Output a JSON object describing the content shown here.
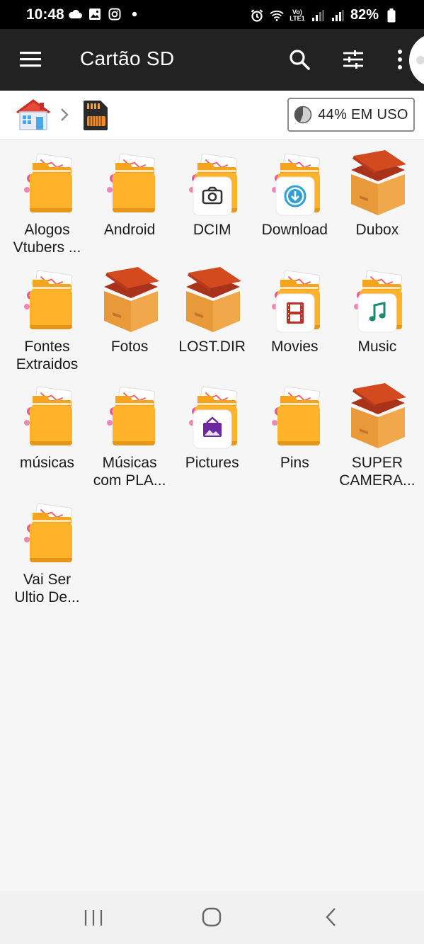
{
  "status_bar": {
    "time": "10:48",
    "network": "Vo) LTE1",
    "battery": "82%"
  },
  "app_bar": {
    "title": "Cartão SD"
  },
  "breadcrumb": {
    "usage_label": "44% EM USO",
    "usage_percent": 44
  },
  "folders": [
    {
      "label": "Alogos\nVtubers ...",
      "icon": "folder-icon",
      "badge": null
    },
    {
      "label": "Android",
      "icon": "folder-icon",
      "badge": null
    },
    {
      "label": "DCIM",
      "icon": "folder-icon",
      "badge": "camera-icon"
    },
    {
      "label": "Download",
      "icon": "folder-icon",
      "badge": "download-icon"
    },
    {
      "label": "Dubox",
      "icon": "box-icon",
      "badge": null
    },
    {
      "label": "Fontes\nExtraidos",
      "icon": "folder-icon",
      "badge": null
    },
    {
      "label": "Fotos",
      "icon": "box-icon",
      "badge": null
    },
    {
      "label": "LOST.DIR",
      "icon": "box-icon",
      "badge": null
    },
    {
      "label": "Movies",
      "icon": "folder-icon",
      "badge": "film-icon"
    },
    {
      "label": "Music",
      "icon": "folder-icon",
      "badge": "music-note-icon"
    },
    {
      "label": "músicas",
      "icon": "folder-icon",
      "badge": null
    },
    {
      "label": "Músicas\ncom PLA...",
      "icon": "folder-icon",
      "badge": null
    },
    {
      "label": "Pictures",
      "icon": "folder-icon",
      "badge": "picture-icon"
    },
    {
      "label": "Pins",
      "icon": "folder-icon",
      "badge": null
    },
    {
      "label": "SUPER\nCAMERA...",
      "icon": "box-icon",
      "badge": null
    },
    {
      "label": "Vai Ser\nUltio De...",
      "icon": "folder-icon",
      "badge": null
    }
  ],
  "colors": {
    "app_bar": "#222222",
    "folder": "#ffb32a",
    "box": "#e89a3a",
    "box_lid": "#d24a1e",
    "badge_camera": "#333333",
    "badge_download": "#2f9fd6",
    "badge_film": "#b8322a",
    "badge_music": "#1c8a6e",
    "badge_picture": "#6b2aa0"
  }
}
